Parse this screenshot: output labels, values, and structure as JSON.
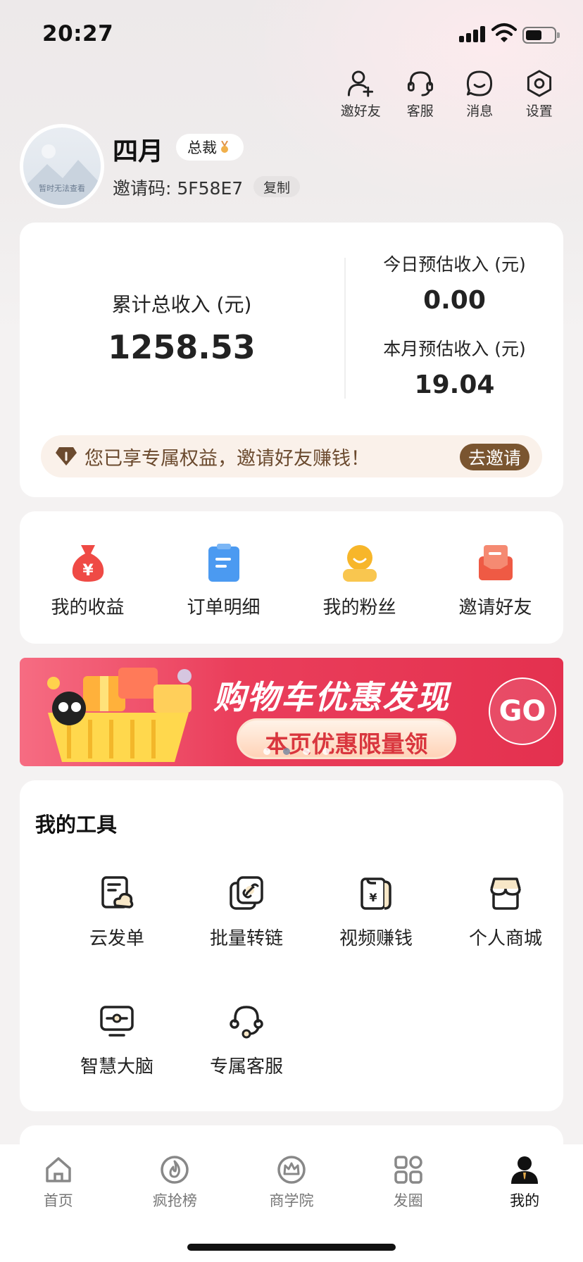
{
  "status_bar": {
    "time": "20:27"
  },
  "top_actions": [
    {
      "label": "邀好友",
      "icon": "add-user-icon"
    },
    {
      "label": "客服",
      "icon": "headset-icon"
    },
    {
      "label": "消息",
      "icon": "message-icon"
    },
    {
      "label": "设置",
      "icon": "settings-icon"
    }
  ],
  "profile": {
    "avatar_caption": "暂时无法查看",
    "name": "四月",
    "level": "总裁",
    "invite_code_label": "邀请码: 5F58E7",
    "copy_label": "复制"
  },
  "earnings": {
    "total_label": "累计总收入 (元)",
    "total_value": "1258.53",
    "today_label": "今日预估收入 (元)",
    "today_value": "0.00",
    "month_label": "本月预估收入 (元)",
    "month_value": "19.04",
    "benefit_text": "您已享专属权益，邀请好友赚钱！",
    "benefit_button": "去邀请"
  },
  "quick_menu": [
    {
      "label": "我的收益",
      "icon": "money-bag-icon"
    },
    {
      "label": "订单明细",
      "icon": "clipboard-icon"
    },
    {
      "label": "我的粉丝",
      "icon": "fans-icon"
    },
    {
      "label": "邀请好友",
      "icon": "envelope-icon"
    }
  ],
  "banner": {
    "title": "购物车优惠发现",
    "subtitle": "本页优惠限量领",
    "go_label": "GO"
  },
  "tools": {
    "title": "我的工具",
    "items": [
      {
        "label": "云发单",
        "icon": "cloud-send-icon"
      },
      {
        "label": "批量转链",
        "icon": "link-icon"
      },
      {
        "label": "视频赚钱",
        "icon": "video-money-icon"
      },
      {
        "label": "个人商城",
        "icon": "store-icon"
      },
      {
        "label": "智慧大脑",
        "icon": "monitor-icon"
      },
      {
        "label": "专属客服",
        "icon": "headset-icon"
      }
    ]
  },
  "tab_bar": [
    {
      "label": "首页",
      "icon": "home-icon",
      "active": false
    },
    {
      "label": "疯抢榜",
      "icon": "flame-icon",
      "active": false
    },
    {
      "label": "商学院",
      "icon": "crown-icon",
      "active": false
    },
    {
      "label": "发圈",
      "icon": "grid-icon",
      "active": false
    },
    {
      "label": "我的",
      "icon": "user-icon",
      "active": true
    }
  ],
  "colors": {
    "accent_brown": "#7a5530",
    "benefit_bg": "#faf1ea",
    "banner_red": "#e4314f",
    "page_bg": "#f4f2f2"
  }
}
